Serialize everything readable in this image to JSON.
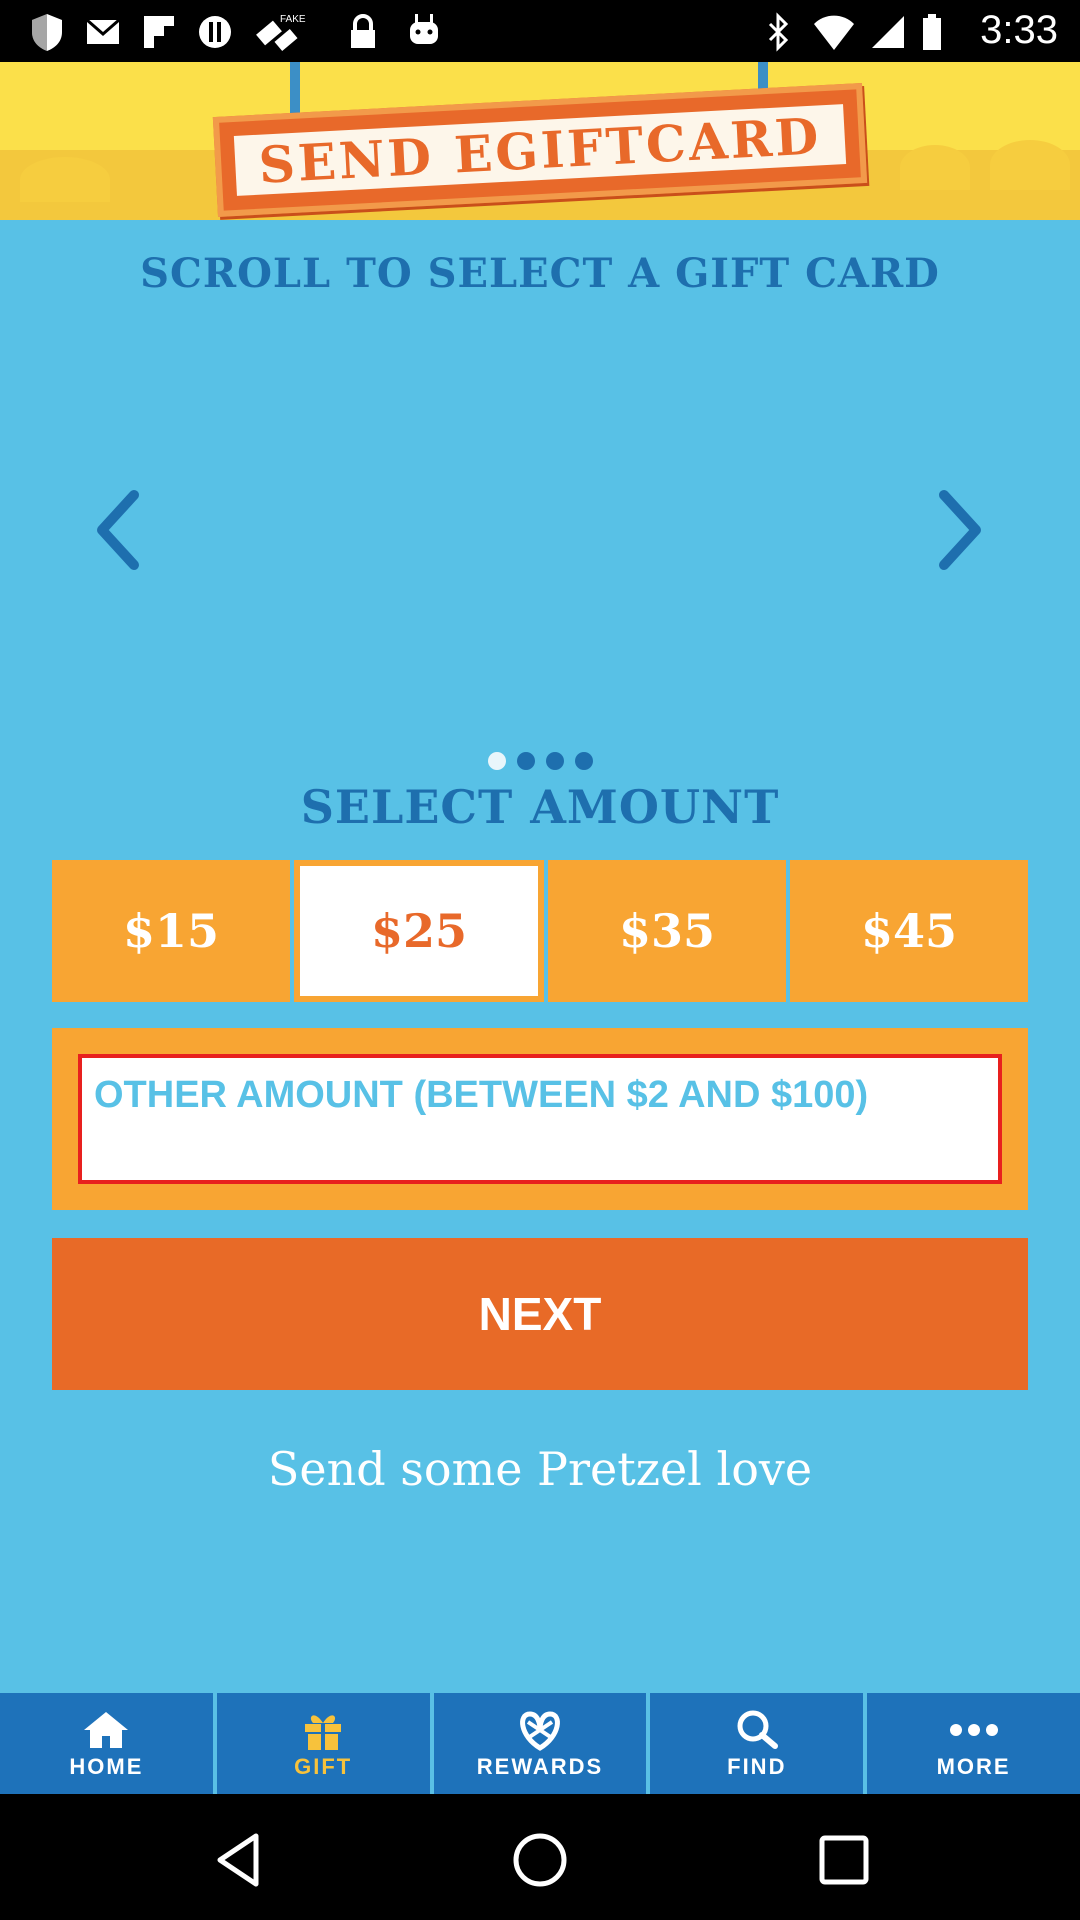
{
  "status_bar": {
    "time": "3:33"
  },
  "header": {
    "title": "SEND EGIFTCARD"
  },
  "carousel": {
    "title": "SCROLL TO SELECT A GIFT CARD",
    "page_count": 4,
    "active_page": 1
  },
  "amount": {
    "title": "SELECT AMOUNT",
    "options": [
      "$15",
      "$25",
      "$35",
      "$45"
    ],
    "selected": "$25",
    "other_placeholder": "OTHER AMOUNT (BETWEEN $2 AND $100)"
  },
  "next_label": "NEXT",
  "tagline": "Send some Pretzel love",
  "bottom_nav": {
    "items": [
      {
        "label": "HOME",
        "icon": "home-icon"
      },
      {
        "label": "GIFT",
        "icon": "gift-icon"
      },
      {
        "label": "REWARDS",
        "icon": "pretzel-icon"
      },
      {
        "label": "FIND",
        "icon": "search-icon"
      },
      {
        "label": "MORE",
        "icon": "more-icon"
      }
    ],
    "active": "GIFT"
  },
  "colors": {
    "brand_blue": "#1e6fae",
    "sky_blue": "#58c1e6",
    "orange": "#e86a27",
    "amber": "#f8a533",
    "error_red": "#e8201e"
  }
}
